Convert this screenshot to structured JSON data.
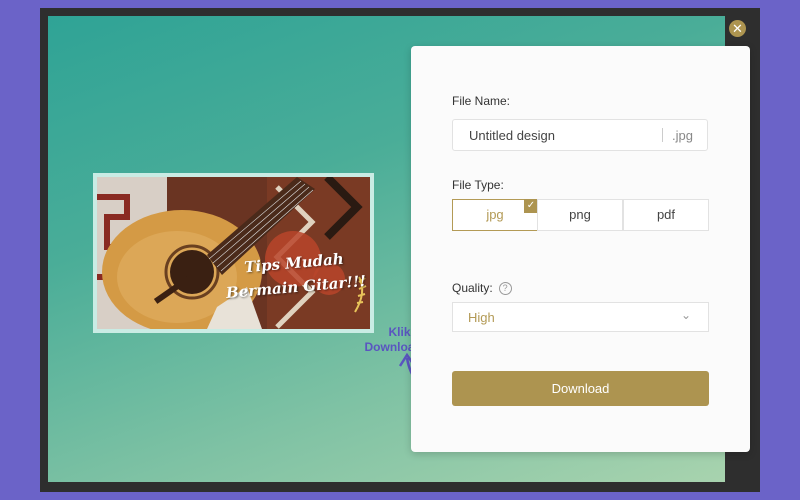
{
  "dialog": {
    "close_icon": "close-icon",
    "file_name_label": "File Name:",
    "file_name_value": "Untitled design",
    "file_name_ext": ".jpg",
    "file_type_label": "File Type:",
    "file_types": [
      {
        "label": "jpg",
        "selected": true
      },
      {
        "label": "png",
        "selected": false
      },
      {
        "label": "pdf",
        "selected": false
      }
    ],
    "quality_label": "Quality:",
    "quality_value": "High",
    "download_label": "Download"
  },
  "thumbnail": {
    "text_line1": "Tips Mudah",
    "text_line2": "Bermain Gitar!!!"
  },
  "annotation": {
    "line1": "Klik untuk",
    "line2": "Download Gambar"
  },
  "colors": {
    "accent": "#ad9450",
    "background": "#6b63c8",
    "annotation": "#5a55c0"
  }
}
